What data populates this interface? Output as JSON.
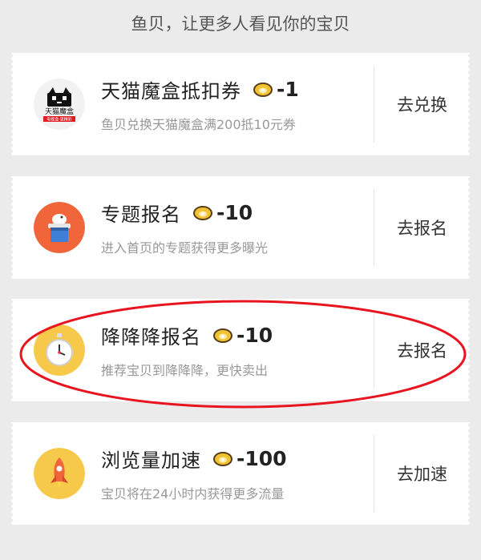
{
  "header": {
    "text": "鱼贝，让更多人看见你的宝贝"
  },
  "items": [
    {
      "title": "天猫魔盒抵扣券",
      "cost": "-1",
      "desc": "鱼贝兑换天猫魔盒满200抵10元券",
      "action": "去兑换",
      "icon": "tmall-magic-box-logo",
      "logo_text": "天猫魔盒",
      "logo_sub": "电视盒·更精彩"
    },
    {
      "title": "专题报名",
      "cost": "-10",
      "desc": "进入首页的专题获得更多曝光",
      "action": "去报名",
      "icon": "magic-hat-icon"
    },
    {
      "title": "降降降报名",
      "cost": "-10",
      "desc": "推荐宝贝到降降降，更快卖出",
      "action": "去报名",
      "icon": "stopwatch-icon"
    },
    {
      "title": "浏览量加速",
      "cost": "-100",
      "desc": "宝贝将在24小时内获得更多流量",
      "action": "去加速",
      "icon": "rocket-icon"
    }
  ],
  "colors": {
    "background": "#ebebeb",
    "card": "#ffffff",
    "highlight": "#e8141f",
    "hat_bg": "#f0653a",
    "yellow_bg": "#f6c94a"
  }
}
